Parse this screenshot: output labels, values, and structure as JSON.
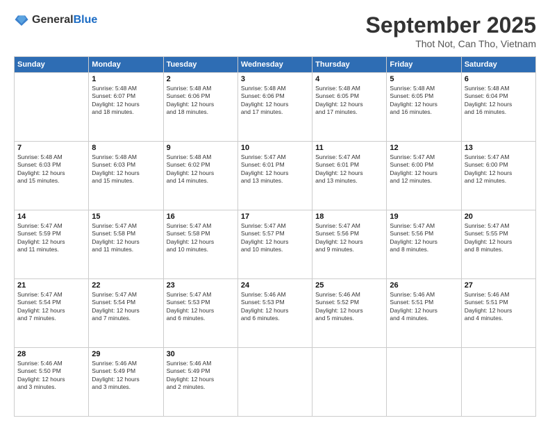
{
  "header": {
    "logo_general": "General",
    "logo_blue": "Blue",
    "month": "September 2025",
    "location": "Thot Not, Can Tho, Vietnam"
  },
  "days_of_week": [
    "Sunday",
    "Monday",
    "Tuesday",
    "Wednesday",
    "Thursday",
    "Friday",
    "Saturday"
  ],
  "weeks": [
    [
      {
        "day": "",
        "info": ""
      },
      {
        "day": "1",
        "info": "Sunrise: 5:48 AM\nSunset: 6:07 PM\nDaylight: 12 hours\nand 18 minutes."
      },
      {
        "day": "2",
        "info": "Sunrise: 5:48 AM\nSunset: 6:06 PM\nDaylight: 12 hours\nand 18 minutes."
      },
      {
        "day": "3",
        "info": "Sunrise: 5:48 AM\nSunset: 6:06 PM\nDaylight: 12 hours\nand 17 minutes."
      },
      {
        "day": "4",
        "info": "Sunrise: 5:48 AM\nSunset: 6:05 PM\nDaylight: 12 hours\nand 17 minutes."
      },
      {
        "day": "5",
        "info": "Sunrise: 5:48 AM\nSunset: 6:05 PM\nDaylight: 12 hours\nand 16 minutes."
      },
      {
        "day": "6",
        "info": "Sunrise: 5:48 AM\nSunset: 6:04 PM\nDaylight: 12 hours\nand 16 minutes."
      }
    ],
    [
      {
        "day": "7",
        "info": "Sunrise: 5:48 AM\nSunset: 6:03 PM\nDaylight: 12 hours\nand 15 minutes."
      },
      {
        "day": "8",
        "info": "Sunrise: 5:48 AM\nSunset: 6:03 PM\nDaylight: 12 hours\nand 15 minutes."
      },
      {
        "day": "9",
        "info": "Sunrise: 5:48 AM\nSunset: 6:02 PM\nDaylight: 12 hours\nand 14 minutes."
      },
      {
        "day": "10",
        "info": "Sunrise: 5:47 AM\nSunset: 6:01 PM\nDaylight: 12 hours\nand 13 minutes."
      },
      {
        "day": "11",
        "info": "Sunrise: 5:47 AM\nSunset: 6:01 PM\nDaylight: 12 hours\nand 13 minutes."
      },
      {
        "day": "12",
        "info": "Sunrise: 5:47 AM\nSunset: 6:00 PM\nDaylight: 12 hours\nand 12 minutes."
      },
      {
        "day": "13",
        "info": "Sunrise: 5:47 AM\nSunset: 6:00 PM\nDaylight: 12 hours\nand 12 minutes."
      }
    ],
    [
      {
        "day": "14",
        "info": "Sunrise: 5:47 AM\nSunset: 5:59 PM\nDaylight: 12 hours\nand 11 minutes."
      },
      {
        "day": "15",
        "info": "Sunrise: 5:47 AM\nSunset: 5:58 PM\nDaylight: 12 hours\nand 11 minutes."
      },
      {
        "day": "16",
        "info": "Sunrise: 5:47 AM\nSunset: 5:58 PM\nDaylight: 12 hours\nand 10 minutes."
      },
      {
        "day": "17",
        "info": "Sunrise: 5:47 AM\nSunset: 5:57 PM\nDaylight: 12 hours\nand 10 minutes."
      },
      {
        "day": "18",
        "info": "Sunrise: 5:47 AM\nSunset: 5:56 PM\nDaylight: 12 hours\nand 9 minutes."
      },
      {
        "day": "19",
        "info": "Sunrise: 5:47 AM\nSunset: 5:56 PM\nDaylight: 12 hours\nand 8 minutes."
      },
      {
        "day": "20",
        "info": "Sunrise: 5:47 AM\nSunset: 5:55 PM\nDaylight: 12 hours\nand 8 minutes."
      }
    ],
    [
      {
        "day": "21",
        "info": "Sunrise: 5:47 AM\nSunset: 5:54 PM\nDaylight: 12 hours\nand 7 minutes."
      },
      {
        "day": "22",
        "info": "Sunrise: 5:47 AM\nSunset: 5:54 PM\nDaylight: 12 hours\nand 7 minutes."
      },
      {
        "day": "23",
        "info": "Sunrise: 5:47 AM\nSunset: 5:53 PM\nDaylight: 12 hours\nand 6 minutes."
      },
      {
        "day": "24",
        "info": "Sunrise: 5:46 AM\nSunset: 5:53 PM\nDaylight: 12 hours\nand 6 minutes."
      },
      {
        "day": "25",
        "info": "Sunrise: 5:46 AM\nSunset: 5:52 PM\nDaylight: 12 hours\nand 5 minutes."
      },
      {
        "day": "26",
        "info": "Sunrise: 5:46 AM\nSunset: 5:51 PM\nDaylight: 12 hours\nand 4 minutes."
      },
      {
        "day": "27",
        "info": "Sunrise: 5:46 AM\nSunset: 5:51 PM\nDaylight: 12 hours\nand 4 minutes."
      }
    ],
    [
      {
        "day": "28",
        "info": "Sunrise: 5:46 AM\nSunset: 5:50 PM\nDaylight: 12 hours\nand 3 minutes."
      },
      {
        "day": "29",
        "info": "Sunrise: 5:46 AM\nSunset: 5:49 PM\nDaylight: 12 hours\nand 3 minutes."
      },
      {
        "day": "30",
        "info": "Sunrise: 5:46 AM\nSunset: 5:49 PM\nDaylight: 12 hours\nand 2 minutes."
      },
      {
        "day": "",
        "info": ""
      },
      {
        "day": "",
        "info": ""
      },
      {
        "day": "",
        "info": ""
      },
      {
        "day": "",
        "info": ""
      }
    ]
  ]
}
